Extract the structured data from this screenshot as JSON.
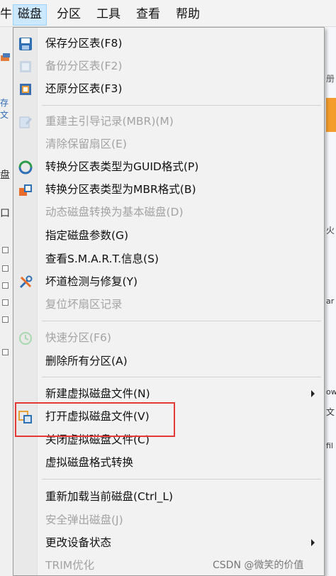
{
  "menubar": {
    "left_fragment": "牛",
    "items": [
      {
        "label": "磁盘"
      },
      {
        "label": "分区"
      },
      {
        "label": "工具"
      },
      {
        "label": "查看"
      },
      {
        "label": "帮助"
      }
    ]
  },
  "background": {
    "frag_save": "存文",
    "frag_pan": "盘",
    "frag_kou": "口",
    "frag_ce": "册",
    "frag_huo": "火",
    "frag_wen": "文",
    "frag_ow": "ow",
    "frag_fil": "fil",
    "frag_ar": "ar"
  },
  "menu": {
    "items": [
      {
        "label": "保存分区表(F8)",
        "disabled": false,
        "icon": "save-icon"
      },
      {
        "label": "备份分区表(F2)",
        "disabled": true,
        "icon": "backup-icon"
      },
      {
        "label": "还原分区表(F3)",
        "disabled": false,
        "icon": "restore-icon"
      },
      {
        "label": "重建主引导记录(MBR)(M)",
        "disabled": true,
        "icon": "rebuild-mbr-icon"
      },
      {
        "label": "清除保留扇区(E)",
        "disabled": true
      },
      {
        "label": "转换分区表类型为GUID格式(P)",
        "disabled": false,
        "icon": "convert-guid-icon"
      },
      {
        "label": "转换分区表类型为MBR格式(B)",
        "disabled": false,
        "icon": "convert-mbr-icon"
      },
      {
        "label": "动态磁盘转换为基本磁盘(D)",
        "disabled": true
      },
      {
        "label": "指定磁盘参数(G)",
        "disabled": false
      },
      {
        "label": "查看S.M.A.R.T.信息(S)",
        "disabled": false
      },
      {
        "label": "坏道检测与修复(Y)",
        "disabled": false,
        "icon": "repair-tools-icon"
      },
      {
        "label": "复位坏扇区记录",
        "disabled": true
      },
      {
        "label": "快速分区(F6)",
        "disabled": true,
        "icon": "quick-partition-icon"
      },
      {
        "label": "删除所有分区(A)",
        "disabled": false
      },
      {
        "label": "新建虚拟磁盘文件(N)",
        "disabled": false,
        "submenu": true
      },
      {
        "label": "打开虚拟磁盘文件(V)",
        "disabled": false,
        "icon": "open-vdisk-icon"
      },
      {
        "label": "关闭虚拟磁盘文件(C)",
        "disabled": false
      },
      {
        "label": "虚拟磁盘格式转换",
        "disabled": false
      },
      {
        "label": "重新加载当前磁盘(Ctrl_L)",
        "disabled": false
      },
      {
        "label": "安全弹出磁盘(J)",
        "disabled": true
      },
      {
        "label": "更改设备状态",
        "disabled": false,
        "submenu": true
      },
      {
        "label": "TRIM优化",
        "disabled": true
      }
    ]
  },
  "colors": {
    "highlight_box": "#e53935",
    "menubar_active": "#cce8ff",
    "disabled_text": "#a3a3a3"
  },
  "watermark": "CSDN @微笑的价值"
}
